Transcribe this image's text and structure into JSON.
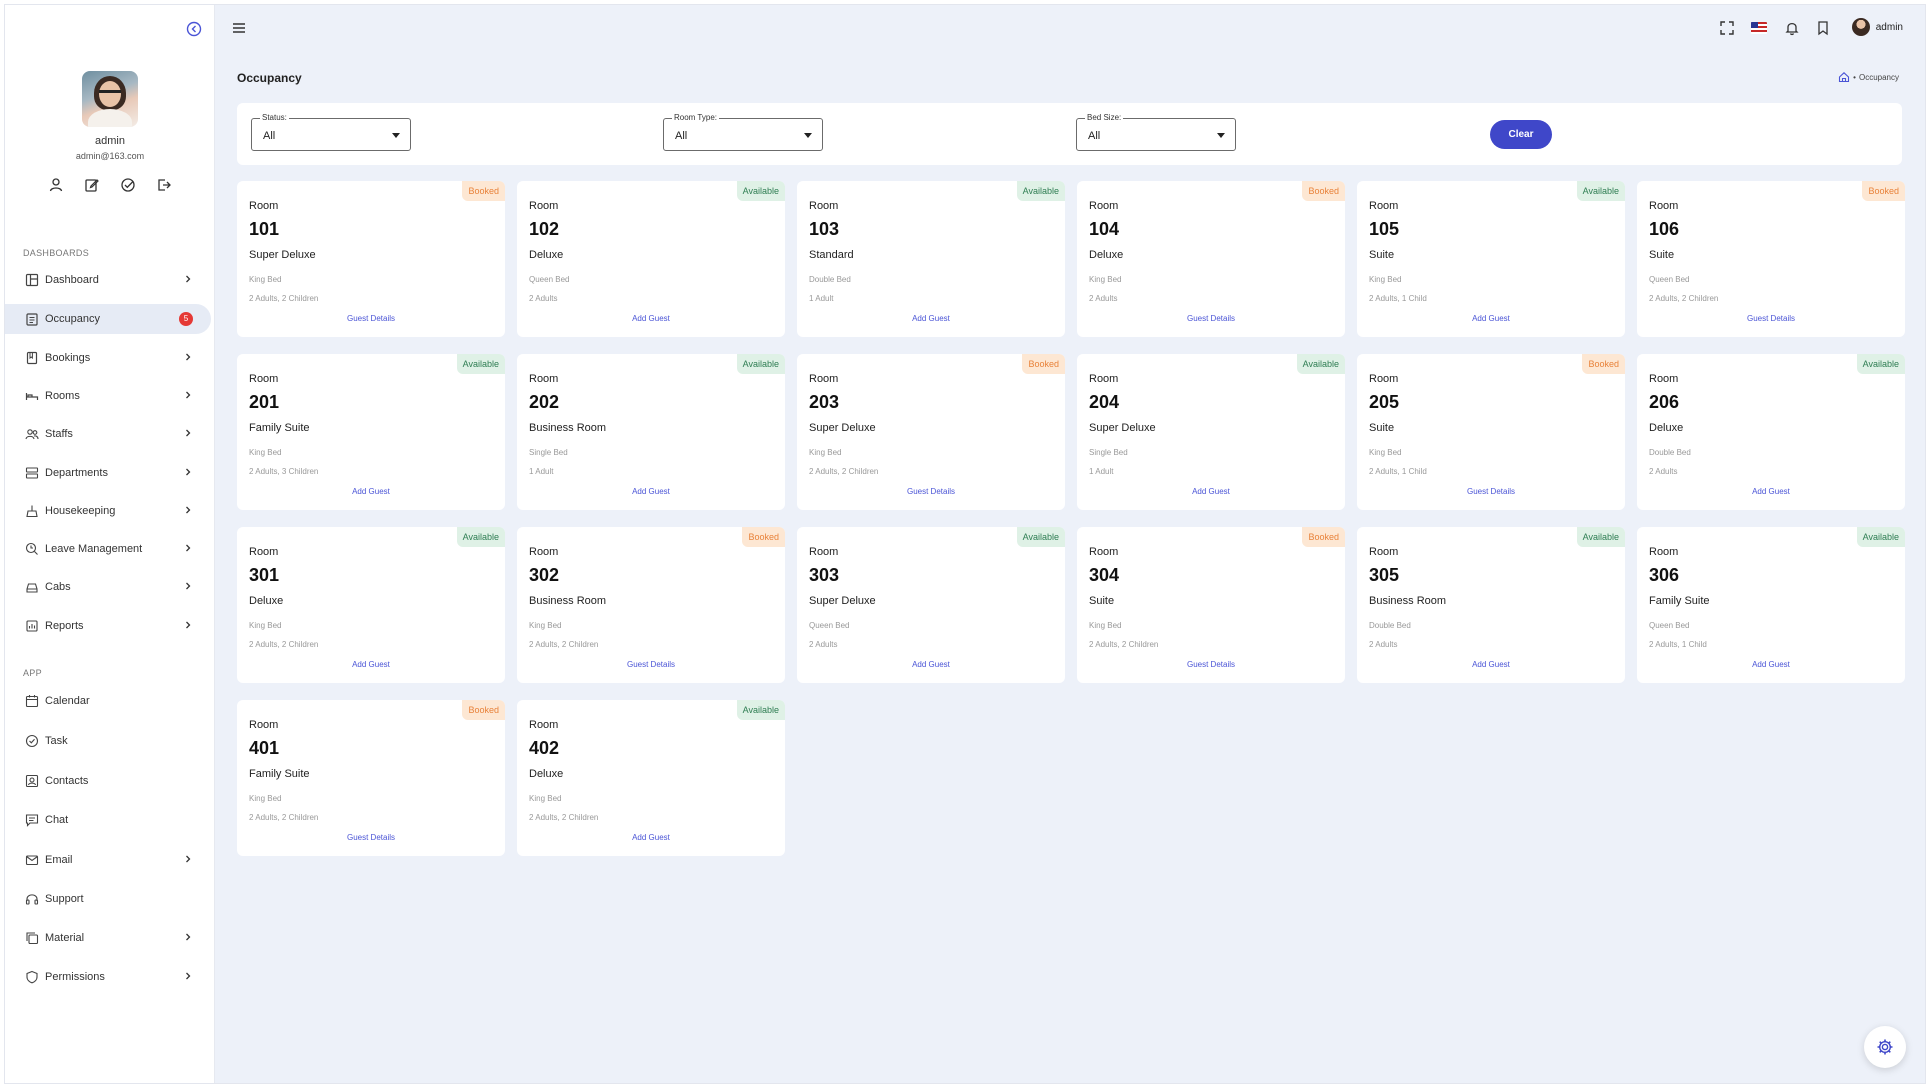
{
  "sidebar": {
    "profile": {
      "name": "admin",
      "email": "admin@163.com"
    },
    "sections": {
      "dashboards": "DASHBOARDS",
      "app": "APP"
    },
    "items": [
      {
        "label": "Dashboard",
        "icon": "layout-icon",
        "chevron": true
      },
      {
        "label": "Occupancy",
        "icon": "clipboard-icon",
        "badge": "5",
        "active": true
      },
      {
        "label": "Bookings",
        "icon": "book-icon",
        "chevron": true
      },
      {
        "label": "Rooms",
        "icon": "bed-icon",
        "chevron": true
      },
      {
        "label": "Staffs",
        "icon": "users-icon",
        "chevron": true
      },
      {
        "label": "Departments",
        "icon": "server-icon",
        "chevron": true
      },
      {
        "label": "Housekeeping",
        "icon": "broom-icon",
        "chevron": true
      },
      {
        "label": "Leave Management",
        "icon": "leave-icon",
        "chevron": true
      },
      {
        "label": "Cabs",
        "icon": "car-icon",
        "chevron": true
      },
      {
        "label": "Reports",
        "icon": "report-icon",
        "chevron": true
      },
      {
        "label": "Calendar",
        "icon": "calendar-icon"
      },
      {
        "label": "Task",
        "icon": "check-circle-icon"
      },
      {
        "label": "Contacts",
        "icon": "contacts-icon"
      },
      {
        "label": "Chat",
        "icon": "chat-icon"
      },
      {
        "label": "Email",
        "icon": "mail-icon",
        "chevron": true
      },
      {
        "label": "Support",
        "icon": "headset-icon"
      },
      {
        "label": "Material",
        "icon": "copy-icon",
        "chevron": true
      },
      {
        "label": "Permissions",
        "icon": "shield-icon",
        "chevron": true
      }
    ]
  },
  "topbar": {
    "user": "admin"
  },
  "page": {
    "title": "Occupancy",
    "breadcrumb": "Occupancy"
  },
  "filters": {
    "status": {
      "label": "Status:",
      "value": "All"
    },
    "room_type": {
      "label": "Room Type:",
      "value": "All"
    },
    "bed_size": {
      "label": "Bed Size:",
      "value": "All"
    },
    "clear": "Clear"
  },
  "room_label": "Room",
  "rooms": [
    {
      "number": "101",
      "status": "Booked",
      "type": "Super Deluxe",
      "bed": "King Bed",
      "occupancy": "2 Adults, 2 Children",
      "action": "Guest Details"
    },
    {
      "number": "102",
      "status": "Available",
      "type": "Deluxe",
      "bed": "Queen Bed",
      "occupancy": "2 Adults",
      "action": "Add Guest"
    },
    {
      "number": "103",
      "status": "Available",
      "type": "Standard",
      "bed": "Double Bed",
      "occupancy": "1 Adult",
      "action": "Add Guest"
    },
    {
      "number": "104",
      "status": "Booked",
      "type": "Deluxe",
      "bed": "King Bed",
      "occupancy": "2 Adults",
      "action": "Guest Details"
    },
    {
      "number": "105",
      "status": "Available",
      "type": "Suite",
      "bed": "King Bed",
      "occupancy": "2 Adults, 1 Child",
      "action": "Add Guest"
    },
    {
      "number": "106",
      "status": "Booked",
      "type": "Suite",
      "bed": "Queen Bed",
      "occupancy": "2 Adults, 2 Children",
      "action": "Guest Details"
    },
    {
      "number": "201",
      "status": "Available",
      "type": "Family Suite",
      "bed": "King Bed",
      "occupancy": "2 Adults, 3 Children",
      "action": "Add Guest"
    },
    {
      "number": "202",
      "status": "Available",
      "type": "Business Room",
      "bed": "Single Bed",
      "occupancy": "1 Adult",
      "action": "Add Guest"
    },
    {
      "number": "203",
      "status": "Booked",
      "type": "Super Deluxe",
      "bed": "King Bed",
      "occupancy": "2 Adults, 2 Children",
      "action": "Guest Details"
    },
    {
      "number": "204",
      "status": "Available",
      "type": "Super Deluxe",
      "bed": "Single Bed",
      "occupancy": "1 Adult",
      "action": "Add Guest"
    },
    {
      "number": "205",
      "status": "Booked",
      "type": "Suite",
      "bed": "King Bed",
      "occupancy": "2 Adults, 1 Child",
      "action": "Guest Details"
    },
    {
      "number": "206",
      "status": "Available",
      "type": "Deluxe",
      "bed": "Double Bed",
      "occupancy": "2 Adults",
      "action": "Add Guest"
    },
    {
      "number": "301",
      "status": "Available",
      "type": "Deluxe",
      "bed": "King Bed",
      "occupancy": "2 Adults, 2 Children",
      "action": "Add Guest"
    },
    {
      "number": "302",
      "status": "Booked",
      "type": "Business Room",
      "bed": "King Bed",
      "occupancy": "2 Adults, 2 Children",
      "action": "Guest Details"
    },
    {
      "number": "303",
      "status": "Available",
      "type": "Super Deluxe",
      "bed": "Queen Bed",
      "occupancy": "2 Adults",
      "action": "Add Guest"
    },
    {
      "number": "304",
      "status": "Booked",
      "type": "Suite",
      "bed": "King Bed",
      "occupancy": "2 Adults, 2 Children",
      "action": "Guest Details"
    },
    {
      "number": "305",
      "status": "Available",
      "type": "Business Room",
      "bed": "Double Bed",
      "occupancy": "2 Adults",
      "action": "Add Guest"
    },
    {
      "number": "306",
      "status": "Available",
      "type": "Family Suite",
      "bed": "Queen Bed",
      "occupancy": "2 Adults, 1 Child",
      "action": "Add Guest"
    },
    {
      "number": "401",
      "status": "Booked",
      "type": "Family Suite",
      "bed": "King Bed",
      "occupancy": "2 Adults, 2 Children",
      "action": "Guest Details"
    },
    {
      "number": "402",
      "status": "Available",
      "type": "Deluxe",
      "bed": "King Bed",
      "occupancy": "2 Adults, 2 Children",
      "action": "Add Guest"
    }
  ],
  "colors": {
    "accent": "#3f47c9",
    "booked_bg": "#fde7d3",
    "booked_text": "#e8823a",
    "available_bg": "#dff1e6",
    "available_text": "#2e7d52",
    "badge_red": "#e53935"
  }
}
